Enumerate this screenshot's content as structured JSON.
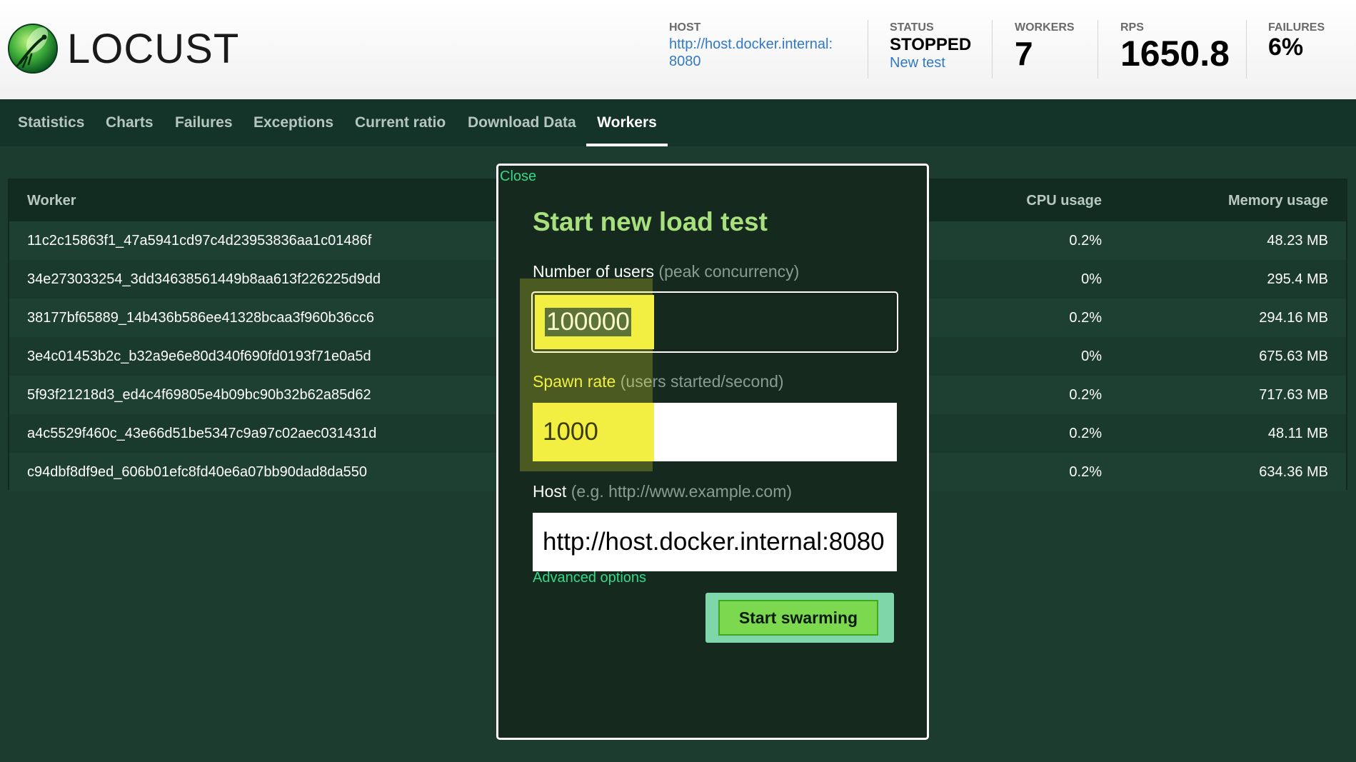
{
  "header": {
    "logo_text": "LOCUST",
    "host": {
      "label": "HOST",
      "value_line1": "http://host.docker.internal:",
      "value_line2": "8080"
    },
    "status": {
      "label": "STATUS",
      "value": "STOPPED",
      "link": "New test"
    },
    "workers": {
      "label": "WORKERS",
      "value": "7"
    },
    "rps": {
      "label": "RPS",
      "value": "1650.8"
    },
    "failures": {
      "label": "FAILURES",
      "value": "6%"
    }
  },
  "nav": {
    "tabs": [
      "Statistics",
      "Charts",
      "Failures",
      "Exceptions",
      "Current ratio",
      "Download Data",
      "Workers"
    ],
    "active": "Workers"
  },
  "table": {
    "columns": {
      "worker": "Worker",
      "cpu": "CPU usage",
      "memory": "Memory usage"
    },
    "rows": [
      {
        "worker": "11c2c15863f1_47a5941cd97c4d23953836aa1c01486f",
        "cpu": "0.2%",
        "memory": "48.23 MB"
      },
      {
        "worker": "34e273033254_3dd34638561449b8aa613f226225d9dd",
        "cpu": "0%",
        "memory": "295.4 MB"
      },
      {
        "worker": "38177bf65889_14b436b586ee41328bcaa3f960b36cc6",
        "cpu": "0.2%",
        "memory": "294.16 MB"
      },
      {
        "worker": "3e4c01453b2c_b32a9e6e80d340f690fd0193f71e0a5d",
        "cpu": "0%",
        "memory": "675.63 MB"
      },
      {
        "worker": "5f93f21218d3_ed4c4f69805e4b09bc90b32b62a85d62",
        "cpu": "0.2%",
        "memory": "717.63 MB"
      },
      {
        "worker": "a4c5529f460c_43e66d51be5347c9a97c02aec031431d",
        "cpu": "0.2%",
        "memory": "48.11 MB"
      },
      {
        "worker": "c94dbf8df9ed_606b01efc8fd40e6a07bb90dad8da550",
        "cpu": "0.2%",
        "memory": "634.36 MB"
      }
    ]
  },
  "modal": {
    "close_label": "Close",
    "title": "Start new load test",
    "users": {
      "label": "Number of users",
      "hint": "(peak concurrency)",
      "value": "100000"
    },
    "spawn": {
      "label": "Spawn rate",
      "hint": "(users started/second)",
      "value": "1000"
    },
    "host": {
      "label": "Host",
      "hint": "(e.g. http://www.example.com)",
      "value": "http://host.docker.internal:8080"
    },
    "advanced_label": "Advanced options",
    "submit_label": "Start swarming"
  },
  "colors": {
    "accent_green": "#a8e07e",
    "link_green": "#36d787",
    "button_green": "#7bd84f",
    "link_blue": "#3179c4",
    "background": "#1c3c30"
  }
}
